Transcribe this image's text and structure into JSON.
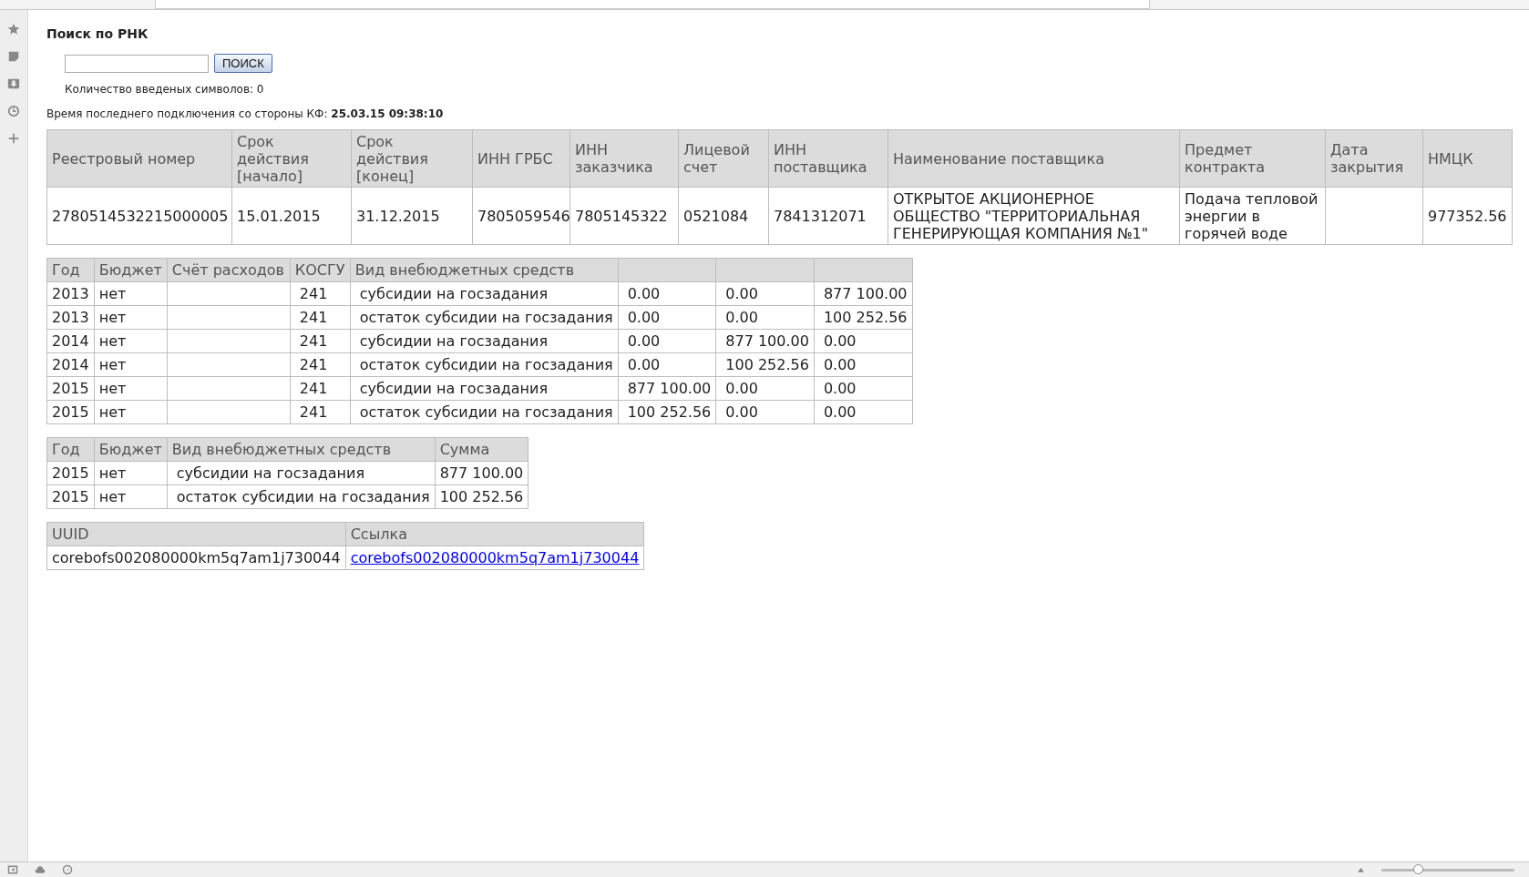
{
  "heading": "Поиск по РНК",
  "search": {
    "button": "ПОИСК"
  },
  "char_count": "Количество введеных символов: 0",
  "last_connection": "Время последнего подключения со стороны КФ: **25.03.15 09:38:10**",
  "contract_table": {
    "columns": [
      "Реестровый номер",
      "Срок действия [начало]",
      "Срок действия [конец]",
      "ИНН ГРБС",
      "ИНН заказчика",
      "Лицевой счет",
      "ИНН поставщика",
      "Наименование поставщика",
      "Предмет контракта",
      "Дата закрытия",
      "НМЦК"
    ],
    "rows": [
      [
        "2780514532215000005",
        "15.01.2015",
        "31.12.2015",
        "7805059546",
        "7805145322",
        "0521084",
        "7841312071",
        "ОТКРЫТОЕ АКЦИОНЕРНОЕ ОБЩЕСТВО \"ТЕРРИТОРИАЛЬНАЯ ГЕНЕРИРУЮЩАЯ КОМПАНИЯ №1\"",
        "Подача тепловой энергии в горячей воде",
        "",
        "977352.56"
      ]
    ]
  },
  "funding_table": {
    "columns": [
      "Год",
      "Бюджет",
      "Счёт расходов",
      "КОСГУ",
      "Вид внебюджетных средств",
      "",
      "",
      ""
    ],
    "rows": [
      [
        "2013",
        "нет",
        "",
        "241",
        "субсидии на госзадания",
        "0.00",
        "0.00",
        "877 100.00"
      ],
      [
        "2013",
        "нет",
        "",
        "241",
        "остаток субсидии на госзадания",
        "0.00",
        "0.00",
        "100 252.56"
      ],
      [
        "2014",
        "нет",
        "",
        "241",
        "субсидии на госзадания",
        "0.00",
        "877 100.00",
        "0.00"
      ],
      [
        "2014",
        "нет",
        "",
        "241",
        "остаток субсидии на госзадания",
        "0.00",
        "100 252.56",
        "0.00"
      ],
      [
        "2015",
        "нет",
        "",
        "241",
        "субсидии на госзадания",
        "877 100.00",
        "0.00",
        "0.00"
      ],
      [
        "2015",
        "нет",
        "",
        "241",
        "остаток субсидии на госзадания",
        "100 252.56",
        "0.00",
        "0.00"
      ]
    ]
  },
  "sum_table": {
    "columns": [
      "Год",
      "Бюджет",
      "Вид внебюджетных средств",
      "Сумма"
    ],
    "rows": [
      [
        "2015",
        "нет",
        "субсидии на госзадания",
        "877 100.00"
      ],
      [
        "2015",
        "нет",
        "остаток субсидии на госзадания",
        "100 252.56"
      ]
    ]
  },
  "uuid_table": {
    "columns": [
      "UUID",
      "Ссылка"
    ],
    "rows": [
      {
        "uuid": "corebofs002080000km5q7am1j730044",
        "link": "corebofs002080000km5q7am1j730044"
      }
    ]
  },
  "status_bar": {
    "zoom": {
      "level": 0.28
    }
  }
}
